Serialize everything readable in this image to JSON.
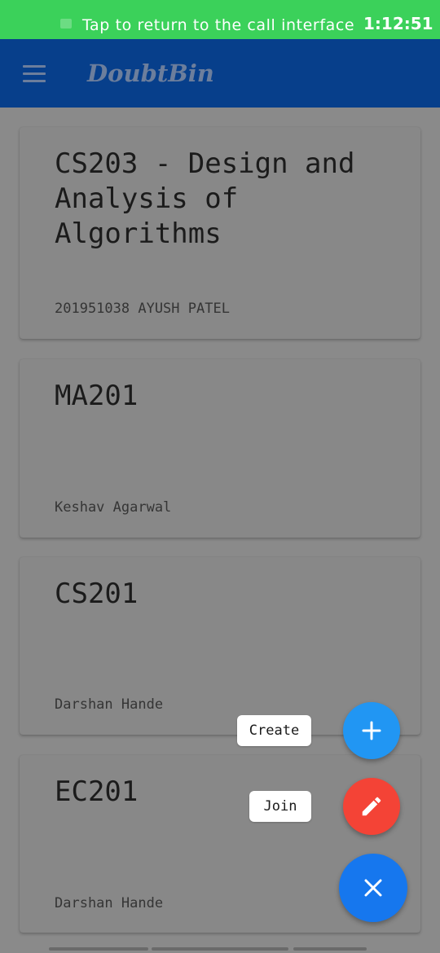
{
  "status_bar": {
    "call_text": "Tap to return to the call interface",
    "time": "1:12:51",
    "color": "#3bd15a"
  },
  "app_bar": {
    "title": "DoubtBin",
    "menu_icon": "hamburger-menu-icon",
    "color": "#073f8b"
  },
  "classes": [
    {
      "title": "CS203 - Design and Analysis of Algorithms",
      "owner": "201951038 AYUSH PATEL"
    },
    {
      "title": "MA201",
      "owner": "Keshav Agarwal"
    },
    {
      "title": "CS201",
      "owner": "Darshan Hande"
    },
    {
      "title": "EC201",
      "owner": "Darshan Hande"
    }
  ],
  "speed_dial": {
    "create_label": "Create",
    "create_icon": "plus-icon",
    "create_color": "#2196f3",
    "join_label": "Join",
    "join_icon": "pencil-icon",
    "join_color": "#f44336",
    "close_icon": "close-icon",
    "close_color": "#1677ee"
  }
}
